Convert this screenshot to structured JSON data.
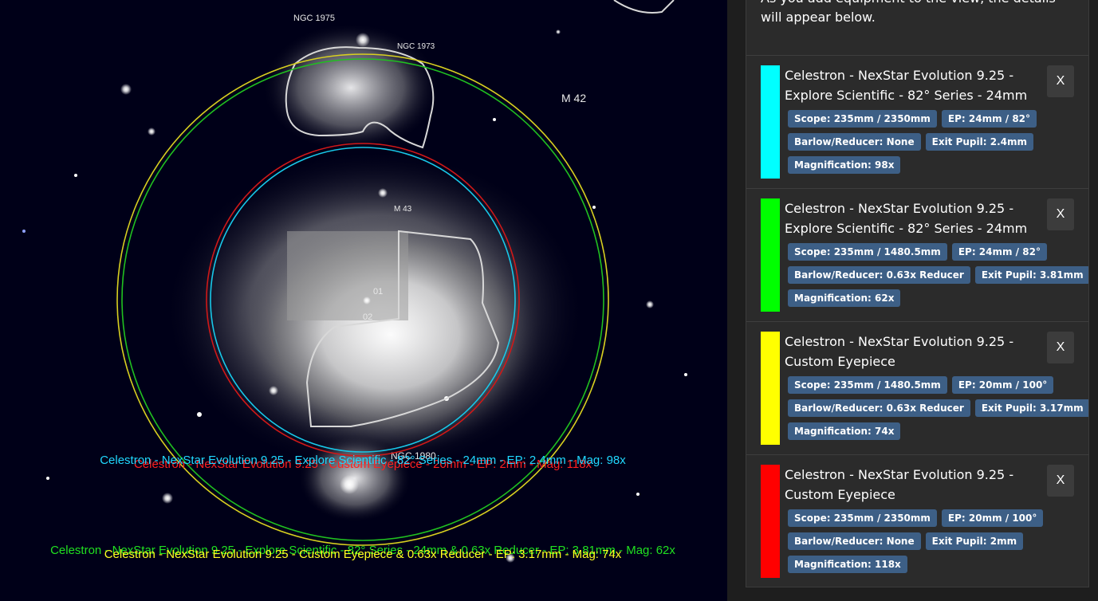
{
  "sky": {
    "objects": [
      {
        "label": "NGC 1975"
      },
      {
        "label": "NGC 1973"
      },
      {
        "label": "M 42"
      },
      {
        "label": "M 43"
      },
      {
        "label": "01"
      },
      {
        "label": "02"
      },
      {
        "label": "NGC 1980"
      }
    ],
    "overlay_labels": [
      {
        "text": "Celestron - NexStar Evolution 9.25 - Custom Eyepiece - 20mm - EP: 2mm - Mag: 118x",
        "color": "#ff2020"
      },
      {
        "text": "Celestron - NexStar Evolution 9.25 - Explore Scientific - 82° Series - 24mm - EP: 2.4mm - Mag: 98x",
        "color": "#20d8ff"
      },
      {
        "text": "Celestron - NexStar Evolution 9.25 - Explore Scientific - 82° Series - 24mm & 0.63x Reducer - EP: 3.81mm - Mag: 62x",
        "color": "#20e020"
      },
      {
        "text": "Celestron - NexStar Evolution 9.25 - Custom Eyepiece & 0.63x Reducer - EP: 3.17mm - Mag: 74x",
        "color": "#ffff20"
      }
    ]
  },
  "panel": {
    "intro": "As you add equipment to the view, the details will appear below.",
    "close_label": "X",
    "cards": [
      {
        "color": "#00ffff",
        "title": "Celestron - NexStar Evolution 9.25 - Explore Scientific - 82° Series - 24mm",
        "scope": "Scope: 235mm / 2350mm",
        "ep": "EP: 24mm / 82°",
        "barlow": "Barlow/Reducer: None",
        "exit_pupil": "Exit Pupil: 2.4mm",
        "magnification": "Magnification: 98x"
      },
      {
        "color": "#00ff00",
        "title": "Celestron - NexStar Evolution 9.25 - Explore Scientific - 82° Series - 24mm",
        "scope": "Scope: 235mm / 1480.5mm",
        "ep": "EP: 24mm / 82°",
        "barlow": "Barlow/Reducer: 0.63x Reducer",
        "exit_pupil": "Exit Pupil: 3.81mm",
        "magnification": "Magnification: 62x"
      },
      {
        "color": "#ffff00",
        "title": "Celestron - NexStar Evolution 9.25 - Custom Eyepiece",
        "scope": "Scope: 235mm / 1480.5mm",
        "ep": "EP: 20mm / 100°",
        "barlow": "Barlow/Reducer: 0.63x Reducer",
        "exit_pupil": "Exit Pupil: 3.17mm",
        "magnification": "Magnification: 74x"
      },
      {
        "color": "#ff0000",
        "title": "Celestron - NexStar Evolution 9.25 - Custom Eyepiece",
        "scope": "Scope: 235mm / 2350mm",
        "ep": "EP: 20mm / 100°",
        "barlow": "Barlow/Reducer: None",
        "exit_pupil": "Exit Pupil: 2mm",
        "magnification": "Magnification: 118x"
      }
    ]
  }
}
